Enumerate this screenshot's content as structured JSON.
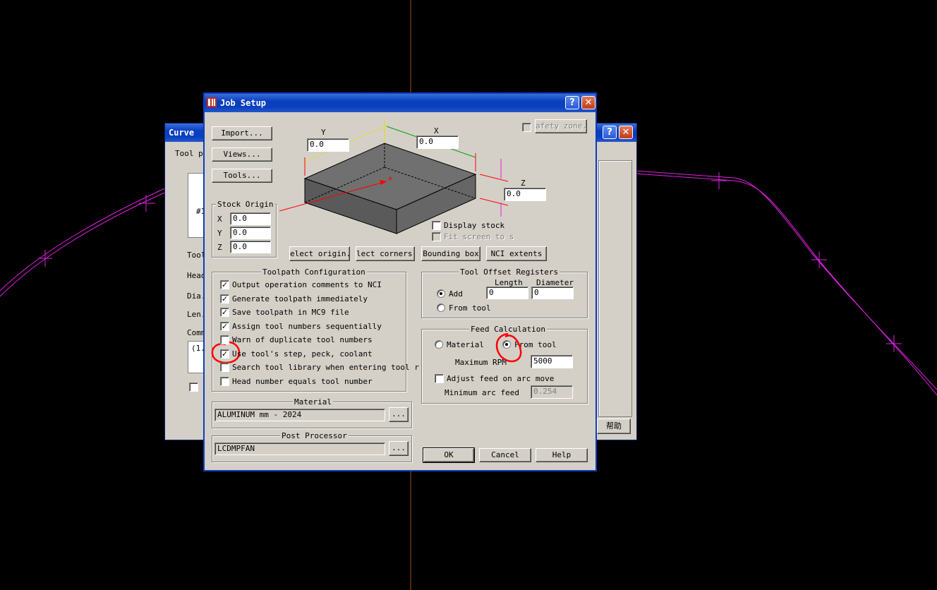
{
  "back_dialog": {
    "title": "Curve",
    "labels": [
      "Tool pa",
      "#1",
      "Tool",
      "Head",
      "Dia.",
      "Len.",
      "Comm",
      "(1."
    ],
    "help_label": "帮助"
  },
  "dialog": {
    "title": "Job Setup",
    "buttons": {
      "import": "Import...",
      "views": "Views...",
      "tools": "Tools...",
      "safety_zone": "afety zone.",
      "select_origin": "elect origin..",
      "select_corners": "lect corners.",
      "bounding_box": "Bounding box",
      "nci_extents": "NCI extents",
      "ok": "OK",
      "cancel": "Cancel",
      "help": "Help",
      "material_browse": "...",
      "post_browse": "..."
    },
    "stock_dims": {
      "y_label": "Y",
      "y_value": "0.0",
      "x_label": "X",
      "x_value": "0.0",
      "z_label": "Z",
      "z_value": "0.0"
    },
    "stock_options": {
      "display_stock": "Display stock",
      "fit_screen": "Fit screen to s"
    },
    "stock_origin": {
      "title": "Stock Origin",
      "x_label": "X",
      "x_value": "0.0",
      "y_label": "Y",
      "y_value": "0.0",
      "z_label": "Z",
      "z_value": "0.0"
    },
    "toolpath_config": {
      "title": "Toolpath Configuration",
      "options": [
        {
          "label": "Output operation comments to NCI",
          "checked": true
        },
        {
          "label": "Generate toolpath immediately",
          "checked": true
        },
        {
          "label": "Save toolpath in MC9 file",
          "checked": true
        },
        {
          "label": "Assign tool numbers sequentially",
          "checked": true
        },
        {
          "label": "Warn of duplicate tool numbers",
          "checked": false
        },
        {
          "label": "Use tool's step, peck, coolant",
          "checked": true
        },
        {
          "label": "Search tool library when entering tool r",
          "checked": false
        },
        {
          "label": "Head number equals tool number",
          "checked": false
        }
      ]
    },
    "tool_offset": {
      "title": "Tool Offset Registers",
      "length_header": "Length",
      "diameter_header": "Diameter",
      "add_label": "Add",
      "from_tool_label": "From tool",
      "length_value": "0",
      "diameter_value": "0"
    },
    "feed_calc": {
      "title": "Feed Calculation",
      "material_label": "Material",
      "from_tool_label": "From tool",
      "max_rpm_label": "Maximum RPM",
      "max_rpm_value": "5000",
      "adjust_feed_label": "Adjust feed on arc move",
      "min_arc_feed_label": "Minimum arc feed",
      "min_arc_feed_value": "0.254"
    },
    "material": {
      "title": "Material",
      "value": "ALUMINUM mm - 2024"
    },
    "post_processor": {
      "title": "Post Processor",
      "value": "LCDMPFAN"
    }
  },
  "colors": {
    "title_bar": "#0a3fbe",
    "dialog_face": "#d4d0c8",
    "annotation_red": "#ff0000",
    "curve_magenta": "#e020e0",
    "axis_line": "#a0522d"
  }
}
